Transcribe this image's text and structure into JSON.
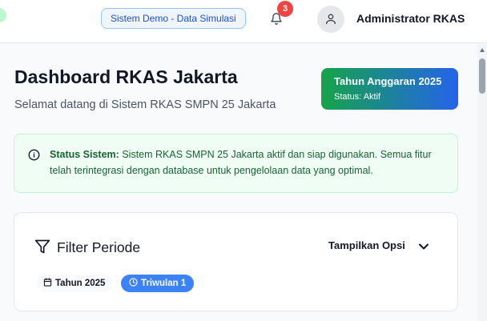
{
  "header": {
    "demo_badge": "Sistem Demo - Data Simulasi",
    "notifications": {
      "count": "3",
      "icon": "bell-icon"
    },
    "user": {
      "name": "Administrator RKAS",
      "icon": "user-icon"
    }
  },
  "page": {
    "title": "Dashboard RKAS Jakarta",
    "subtitle": "Selamat datang di Sistem RKAS SMPN 25 Jakarta"
  },
  "year_card": {
    "title": "Tahun Anggaran 2025",
    "status": "Status: Aktif",
    "gradient": [
      "#16a34a",
      "#2563eb"
    ]
  },
  "alert": {
    "label": "Status Sistem:",
    "message": "Sistem RKAS SMPN 25 Jakarta aktif dan siap digunakan. Semua fitur telah terintegrasi dengan database untuk pengelolaan data yang optimal.",
    "icon": "info-icon"
  },
  "filter": {
    "title": "Filter Periode",
    "options_label": "Tampilkan Opsi",
    "chips": {
      "year": "Tahun 2025",
      "quarter": "Triwulan 1"
    }
  },
  "colors": {
    "accent": "#3b82f6",
    "danger": "#ef4444",
    "success_bg": "#f0fdf4",
    "success_text": "#166534"
  }
}
